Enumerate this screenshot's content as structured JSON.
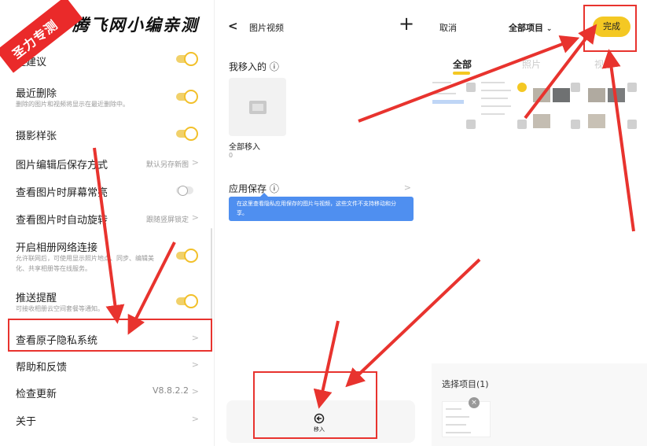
{
  "watermark": {
    "badge": "圣力专测",
    "title": "腾飞网小编亲测"
  },
  "left_panel": {
    "rows": [
      {
        "title": "理建议",
        "toggle": "on"
      },
      {
        "title": "最近删除",
        "subtitle": "删除的图片和视频将显示在最近删除中。",
        "toggle": "on"
      },
      {
        "title": "摄影样张",
        "toggle": "on"
      },
      {
        "title": "图片编辑后保存方式",
        "value": "默认另存新图"
      },
      {
        "title": "查看图片时屏幕常亮",
        "toggle": "off"
      },
      {
        "title": "查看图片时自动旋转",
        "value": "跟随竖屏锁定"
      },
      {
        "title": "开启相册网络连接",
        "subtitle": "允许联网后，可使用显示照片地点、同步、编辑美化、共享相册等在线服务。",
        "toggle": "on"
      },
      {
        "title": "推送提醒",
        "subtitle": "可接收相册云空间套餐等通知。",
        "toggle": "on"
      },
      {
        "title": "查看原子隐私系统"
      },
      {
        "title": "帮助和反馈"
      },
      {
        "title": "检查更新",
        "value": "V8.8.2.2"
      },
      {
        "title": "关于"
      }
    ]
  },
  "middle_panel": {
    "title": "图片视频",
    "section1": "我移入的 ⓘ",
    "folder_caption": "全部移入",
    "folder_count": "0",
    "section2": "应用保存 ⓘ",
    "tip": "在这里查看隐私应用保存的图片与视频，这些文件不支持移动和分享。",
    "move_label": "移入"
  },
  "right_panel": {
    "cancel": "取消",
    "header_title": "全部项目",
    "done": "完成",
    "tabs": [
      "全部",
      "照片",
      "视频"
    ],
    "selected_title": "选择项目(1)"
  },
  "colors": {
    "accent": "#f4c823",
    "highlight": "#e8332e",
    "tip_blue": "#4f8ff0"
  }
}
